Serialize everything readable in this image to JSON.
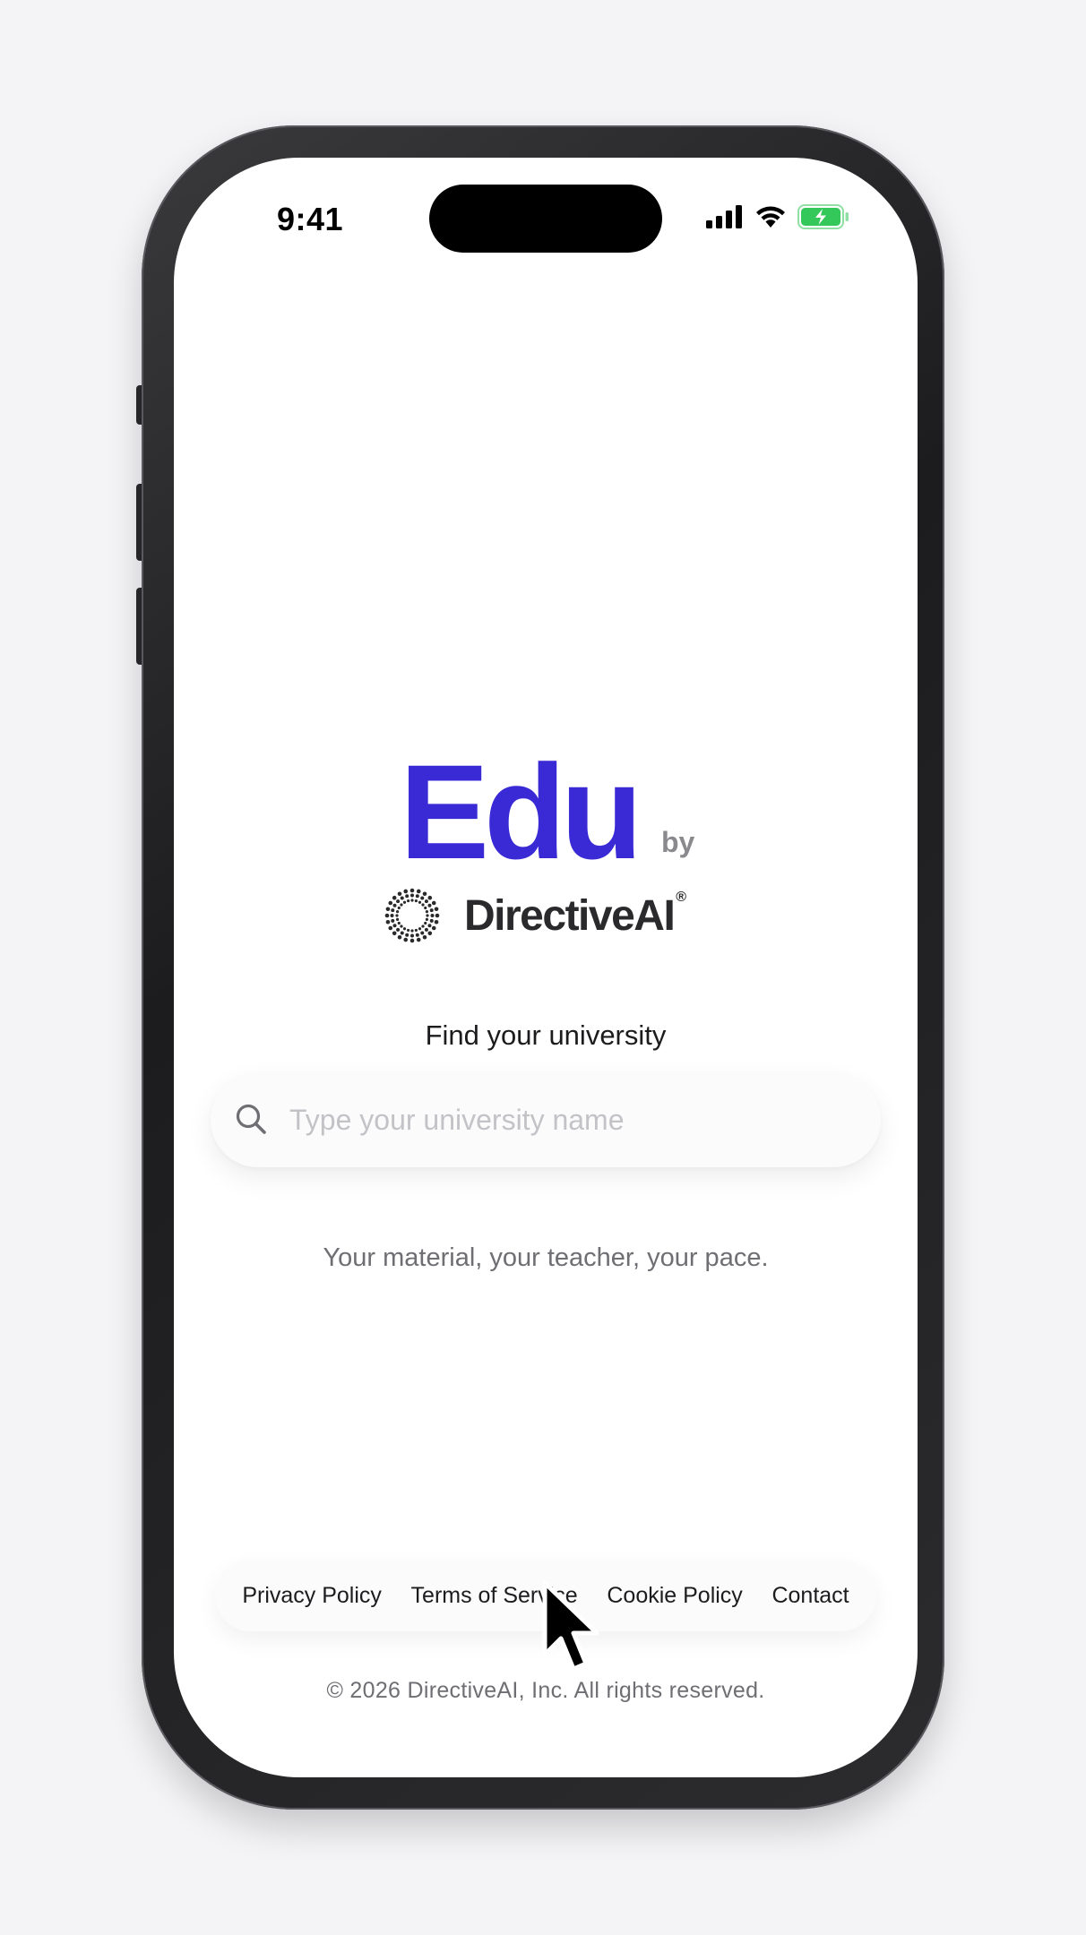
{
  "status_bar": {
    "time": "9:41",
    "icons": [
      "cellular-signal-icon",
      "wifi-icon",
      "battery-charging-icon"
    ],
    "battery_color": "#34c759"
  },
  "brand": {
    "product": "Edu",
    "by": "by",
    "company": "DirectiveAI",
    "registered": "®",
    "product_color": "#3a2ad6",
    "logo_icon": "directiveai-dotted-sunburst-logo"
  },
  "search": {
    "label": "Find your university",
    "placeholder": "Type your university name",
    "value": "",
    "icon": "search-icon"
  },
  "tagline": "Your material, your teacher, your pace.",
  "footer": {
    "links": [
      "Privacy Policy",
      "Terms of Service",
      "Cookie Policy",
      "Contact"
    ],
    "copyright": "© 2026 DirectiveAI, Inc. All rights reserved."
  },
  "pointer": {
    "icon": "mouse-pointer-icon"
  }
}
